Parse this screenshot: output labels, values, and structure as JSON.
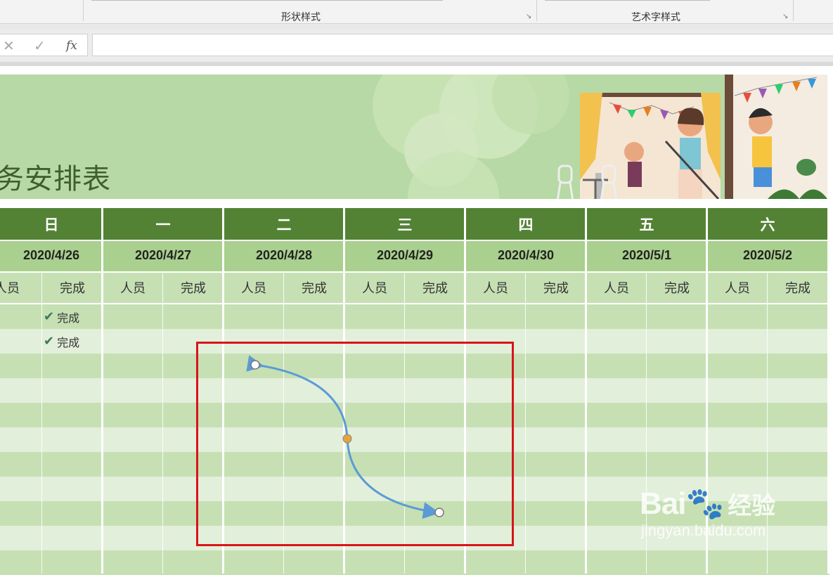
{
  "ribbon": {
    "group1_label": "形状样式",
    "group2_label": "艺术字样式"
  },
  "formula_bar": {
    "cancel_glyph": "✕",
    "enter_glyph": "✓",
    "fx_label": "fx",
    "value": ""
  },
  "banner": {
    "title": "务安排表"
  },
  "schedule": {
    "days": [
      "日",
      "一",
      "二",
      "三",
      "四",
      "五",
      "六"
    ],
    "dates": [
      "2020/4/26",
      "2020/4/27",
      "2020/4/28",
      "2020/4/29",
      "2020/4/30",
      "2020/5/1",
      "2020/5/2"
    ],
    "col_person": "人员",
    "col_done": "完成",
    "done_text_row1": "完成",
    "done_text_row2": "完成"
  },
  "watermark": {
    "logo": "Bai",
    "logo_cn": "经验",
    "url": "jingyan.baidu.com"
  },
  "colors": {
    "header_dark": "#548235",
    "header_mid": "#a9d08e",
    "header_light": "#c6e0b4",
    "row_a": "#c6e0b4",
    "row_b": "#e2efda",
    "selection": "#d9141b",
    "connector": "#5b9bd5"
  }
}
